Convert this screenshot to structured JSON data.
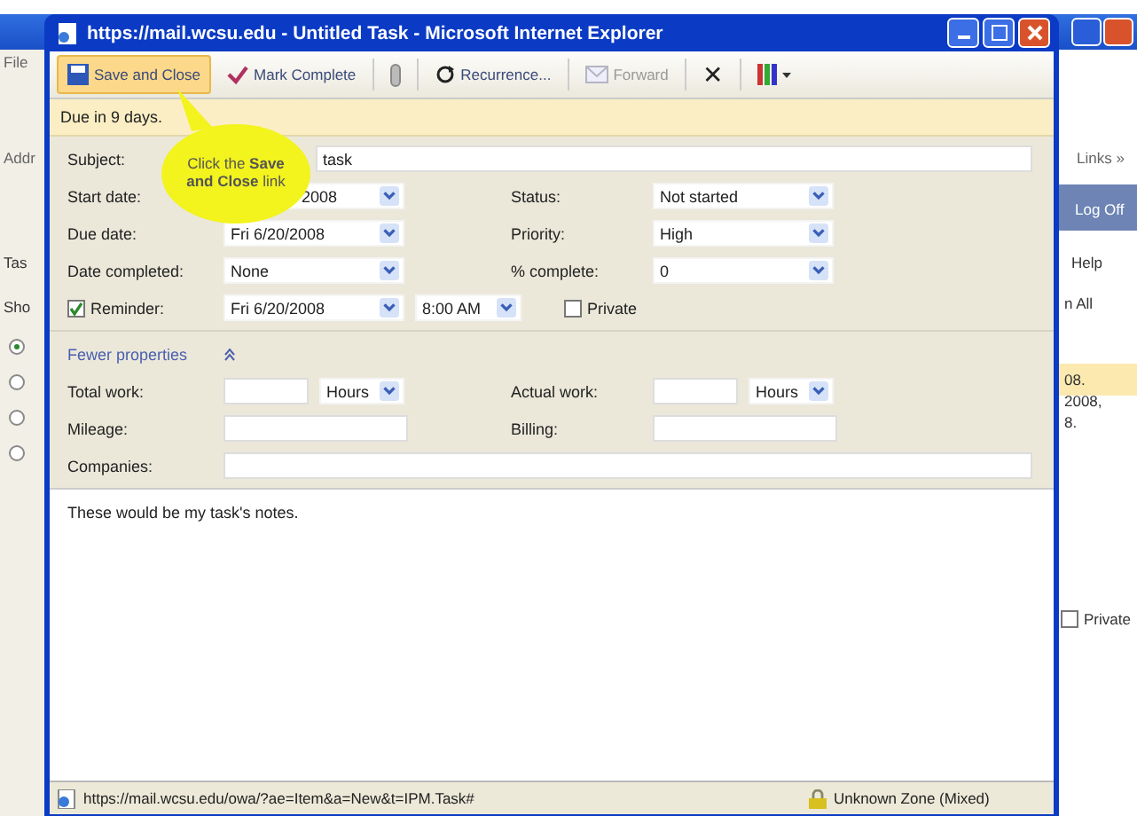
{
  "background_window": {
    "menu_fragment": "File",
    "address_fragment": "Addr",
    "tasks_fragment": "Tas",
    "show_fragment": "Sho",
    "links": "Links »",
    "log_off": "Log Off",
    "help": "Help",
    "reply_all_fragment": "n All",
    "preview_lines": [
      "08.",
      "2008,",
      "8."
    ],
    "private_label": "Private",
    "private": false,
    "radios": [
      {
        "selected": true
      },
      {
        "selected": false
      },
      {
        "selected": false
      },
      {
        "selected": false
      }
    ]
  },
  "window": {
    "title": "https://mail.wcsu.edu - Untitled Task - Microsoft Internet Explorer"
  },
  "toolbar": [
    {
      "kind": "save",
      "label": "Save and Close",
      "highlighted": true,
      "disabled": false
    },
    {
      "kind": "complete",
      "label": "Mark Complete",
      "highlighted": false,
      "disabled": false
    },
    {
      "kind": "attach",
      "highlighted": false,
      "disabled": false
    },
    {
      "kind": "recurrence",
      "label": "Recurrence...",
      "highlighted": false,
      "disabled": false
    },
    {
      "kind": "forward",
      "label": "Forward",
      "highlighted": false,
      "disabled": true
    },
    {
      "kind": "delete",
      "label": "✕",
      "highlighted": false,
      "disabled": false
    },
    {
      "kind": "categories",
      "highlighted": false,
      "disabled": false
    }
  ],
  "info_bar": "Due in 9 days.",
  "callout": "Click the **Save and Close** link",
  "subject": {
    "label": "Subject:",
    "value": "task"
  },
  "rows": [
    {
      "left": {
        "label": "Start date:",
        "value": "2008"
      },
      "right": {
        "label": "Status:",
        "value": "Not started"
      }
    },
    {
      "left": {
        "label": "Due date:",
        "value": "Fri 6/20/2008"
      },
      "right": {
        "label": "Priority:",
        "value": "High"
      }
    },
    {
      "left": {
        "label": "Date completed:",
        "value": "None"
      },
      "right": {
        "label": "% complete:",
        "value": "0"
      }
    }
  ],
  "reminder": {
    "label": "Reminder:",
    "checked": true,
    "date": "Fri 6/20/2008",
    "time": "8:00 AM",
    "private_label": "Private",
    "private": false
  },
  "fewer_properties": "Fewer properties",
  "work": [
    {
      "label": "Total work:",
      "unit": "Hours"
    },
    {
      "label": "Actual work:",
      "unit": "Hours"
    }
  ],
  "mileage": {
    "label": "Mileage:"
  },
  "billing": {
    "label": "Billing:"
  },
  "companies": {
    "label": "Companies:"
  },
  "notes": "These would be my task's notes.",
  "status_bar": {
    "url": "https://mail.wcsu.edu/owa/?ae=Item&a=New&t=IPM.Task#",
    "zone": "Unknown Zone (Mixed)"
  }
}
